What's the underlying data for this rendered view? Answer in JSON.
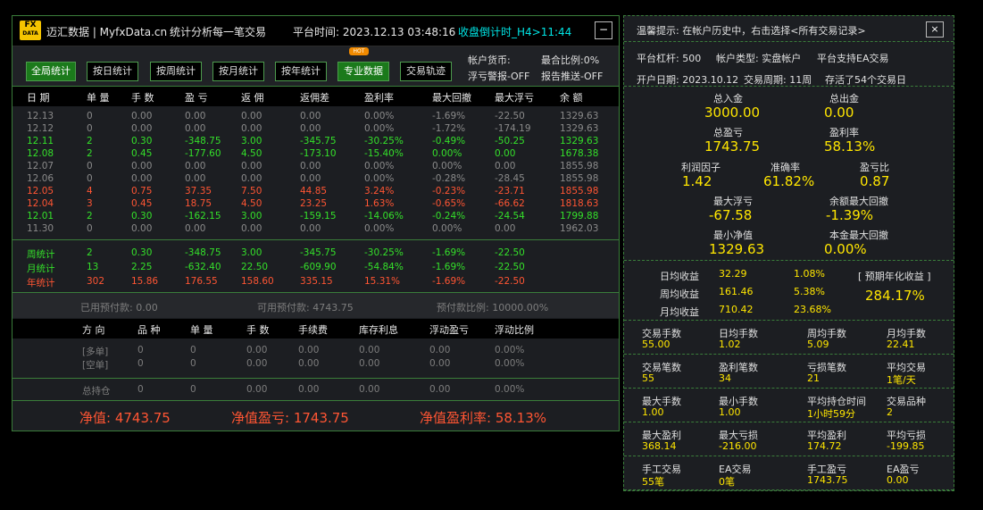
{
  "header": {
    "logo_top": "FX",
    "logo_bottom": "DATA",
    "app_title": "迈汇数据 | MyfxData.cn",
    "subtitle": "统计分析每一笔交易",
    "platform_time": "平台时间: 2023.12.13 03:48:16",
    "countdown": "收盘倒计时_H4>11:44",
    "minimize": "−"
  },
  "toolbar": {
    "buttons": [
      "全局统计",
      "按日统计",
      "按周统计",
      "按月统计",
      "按年统计",
      "专业数据",
      "交易轨迹"
    ],
    "hot_badge": "HOT",
    "currency": "帐户货币:",
    "max_ratio": "最合比例:0%",
    "float_alert": "浮亏警报-OFF",
    "report_push": "报告推送-OFF"
  },
  "daily_table": {
    "headers": [
      "日 期",
      "单 量",
      "手 数",
      "盈 亏",
      "返 佣",
      "返佣差",
      "盈利率",
      "最大回撤",
      "最大浮亏",
      "余 额"
    ],
    "rows": [
      {
        "c": "grey",
        "v": [
          "12.13",
          "0",
          "0.00",
          "0.00",
          "0.00",
          "0.00",
          "0.00%",
          "-1.69%",
          "-22.50",
          "1329.63"
        ]
      },
      {
        "c": "grey",
        "v": [
          "12.12",
          "0",
          "0.00",
          "0.00",
          "0.00",
          "0.00",
          "0.00%",
          "-1.72%",
          "-174.19",
          "1329.63"
        ]
      },
      {
        "c": "green",
        "v": [
          "12.11",
          "2",
          "0.30",
          "-348.75",
          "3.00",
          "-345.75",
          "-30.25%",
          "-0.49%",
          "-50.25",
          "1329.63"
        ]
      },
      {
        "c": "green",
        "v": [
          "12.08",
          "2",
          "0.45",
          "-177.60",
          "4.50",
          "-173.10",
          "-15.40%",
          "0.00%",
          "0.00",
          "1678.38"
        ]
      },
      {
        "c": "grey",
        "v": [
          "12.07",
          "0",
          "0.00",
          "0.00",
          "0.00",
          "0.00",
          "0.00%",
          "0.00%",
          "0.00",
          "1855.98"
        ]
      },
      {
        "c": "grey",
        "v": [
          "12.06",
          "0",
          "0.00",
          "0.00",
          "0.00",
          "0.00",
          "0.00%",
          "-0.28%",
          "-28.45",
          "1855.98"
        ]
      },
      {
        "c": "red",
        "v": [
          "12.05",
          "4",
          "0.75",
          "37.35",
          "7.50",
          "44.85",
          "3.24%",
          "-0.23%",
          "-23.71",
          "1855.98"
        ]
      },
      {
        "c": "red",
        "v": [
          "12.04",
          "3",
          "0.45",
          "18.75",
          "4.50",
          "23.25",
          "1.63%",
          "-0.65%",
          "-66.62",
          "1818.63"
        ]
      },
      {
        "c": "green",
        "v": [
          "12.01",
          "2",
          "0.30",
          "-162.15",
          "3.00",
          "-159.15",
          "-14.06%",
          "-0.24%",
          "-24.54",
          "1799.88"
        ]
      },
      {
        "c": "grey",
        "v": [
          "11.30",
          "0",
          "0.00",
          "0.00",
          "0.00",
          "0.00",
          "0.00%",
          "0.00%",
          "0.00",
          "1962.03"
        ]
      }
    ]
  },
  "summary_rows": [
    {
      "c": "green",
      "v": [
        "周统计",
        "2",
        "0.30",
        "-348.75",
        "3.00",
        "-345.75",
        "-30.25%",
        "-1.69%",
        "-22.50"
      ]
    },
    {
      "c": "green",
      "v": [
        "月统计",
        "13",
        "2.25",
        "-632.40",
        "22.50",
        "-609.90",
        "-54.84%",
        "-1.69%",
        "-22.50"
      ]
    },
    {
      "c": "red",
      "v": [
        "年统计",
        "302",
        "15.86",
        "176.55",
        "158.60",
        "335.15",
        "15.31%",
        "-1.69%",
        "-22.50"
      ]
    }
  ],
  "prepayment": {
    "used": "已用预付款: 0.00",
    "available": "可用预付款: 4743.75",
    "ratio": "预付款比例: 10000.00%"
  },
  "positions": {
    "headers": [
      "方 向",
      "品 种",
      "单 量",
      "手 数",
      "手续费",
      "库存利息",
      "浮动盈亏",
      "浮动比例"
    ],
    "rows": [
      [
        "[多单]",
        "0",
        "0",
        "0.00",
        "0.00",
        "0.00",
        "0.00",
        "0.00%"
      ],
      [
        "[空单]",
        "0",
        "0",
        "0.00",
        "0.00",
        "0.00",
        "0.00",
        "0.00%"
      ]
    ],
    "total": [
      "总持仓",
      "0",
      "0",
      "0.00",
      "0.00",
      "0.00",
      "0.00",
      "0.00%"
    ]
  },
  "net": {
    "equity": "净值: 4743.75",
    "equity_pl": "净值盈亏: 1743.75",
    "equity_rate": "净值盈利率: 58.13%"
  },
  "right": {
    "tip": "温馨提示: 在帐户历史中，右击选择<所有交易记录>",
    "close": "×",
    "leverage": "平台杠杆: 500",
    "acct_type": "帐户类型: 实盘帐户",
    "ea": "平台支持EA交易",
    "open_date": "开户日期: 2023.10.12",
    "period": "交易周期: 11周",
    "stored": "存活了54个交易日",
    "total_deposit_l": "总入金",
    "total_deposit": "3000.00",
    "total_withdraw_l": "总出金",
    "total_withdraw": "0.00",
    "total_pl_l": "总盈亏",
    "total_pl": "1743.75",
    "profit_rate_l": "盈利率",
    "profit_rate": "58.13%",
    "profit_factor_l": "利润因子",
    "profit_factor": "1.42",
    "accuracy_l": "准确率",
    "accuracy": "61.82%",
    "pl_ratio_l": "盈亏比",
    "pl_ratio": "0.87",
    "max_float_l": "最大浮亏",
    "max_float": "-67.58",
    "max_dd_l": "余额最大回撤",
    "max_dd": "-1.39%",
    "min_equity_l": "最小净值",
    "min_equity": "1329.63",
    "principal_dd_l": "本金最大回撤",
    "principal_dd": "0.00%",
    "daily_l": "日均收益",
    "daily_v": "32.29",
    "daily_p": "1.08%",
    "weekly_l": "周均收益",
    "weekly_v": "161.46",
    "weekly_p": "5.38%",
    "monthly_l": "月均收益",
    "monthly_v": "710.42",
    "monthly_p": "23.68%",
    "annual_l": "[ 预期年化收益 ]",
    "annual": "284.17%",
    "grid": [
      [
        [
          "交易手数",
          "55.00"
        ],
        [
          "日均手数",
          "1.02"
        ],
        [
          "周均手数",
          "5.09"
        ],
        [
          "月均手数",
          "22.41"
        ]
      ],
      [
        [
          "交易笔数",
          "55"
        ],
        [
          "盈利笔数",
          "34"
        ],
        [
          "亏损笔数",
          "21"
        ],
        [
          "平均交易",
          "1笔/天"
        ]
      ],
      [
        [
          "最大手数",
          "1.00"
        ],
        [
          "最小手数",
          "1.00"
        ],
        [
          "平均持仓时间",
          "1小时59分"
        ],
        [
          "交易品种",
          "2"
        ]
      ],
      [
        [
          "最大盈利",
          "368.14"
        ],
        [
          "最大亏损",
          "-216.00"
        ],
        [
          "平均盈利",
          "174.72"
        ],
        [
          "平均亏损",
          "-199.85"
        ]
      ],
      [
        [
          "手工交易",
          "55笔"
        ],
        [
          "EA交易",
          "0笔"
        ],
        [
          "手工盈亏",
          "1743.75"
        ],
        [
          "EA盈亏",
          "0.00"
        ]
      ]
    ]
  },
  "colors": {
    "green": "#34e02a",
    "red": "#ff5533",
    "grey": "#8a8a8a",
    "yellow": "#ffe600",
    "accent": "#3a7d3a"
  }
}
